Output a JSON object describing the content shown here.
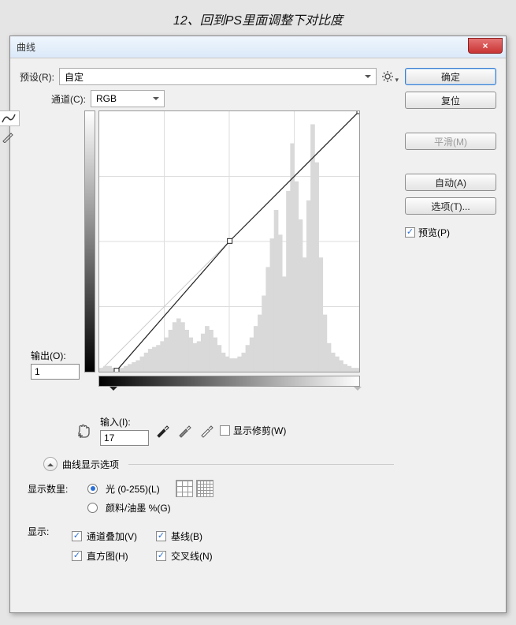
{
  "caption": "12、回到PS里面调整下对比度",
  "window": {
    "title": "曲线",
    "close_glyph": "×"
  },
  "preset": {
    "label": "预设(R):",
    "value": "自定"
  },
  "channel": {
    "label": "通道(C):",
    "value": "RGB"
  },
  "output": {
    "label": "输出(O):",
    "value": "1"
  },
  "input": {
    "label": "输入(I):",
    "value": "17"
  },
  "show_clip": {
    "label": "显示修剪(W)"
  },
  "expander": {
    "label": "曲线显示选项"
  },
  "show_amount": {
    "label": "显示数里:",
    "options": [
      {
        "label": "光 (0-255)(L)",
        "checked": true
      },
      {
        "label": "颜料/油墨 %(G)",
        "checked": false
      }
    ]
  },
  "show": {
    "label": "显示:",
    "checks": {
      "channel_overlay": {
        "label": "通道叠加(V)",
        "checked": true
      },
      "histogram": {
        "label": "直方图(H)",
        "checked": true
      },
      "baseline": {
        "label": "基线(B)",
        "checked": true
      },
      "intersection": {
        "label": "交叉线(N)",
        "checked": true
      }
    }
  },
  "buttons": {
    "ok": "确定",
    "reset": "复位",
    "smooth": "平滑(M)",
    "auto": "自动(A)",
    "options": "选项(T)..."
  },
  "preview": {
    "label": "预览(P)",
    "checked": true
  },
  "chart_data": {
    "type": "line",
    "title": "Curves",
    "xlabel": "Input",
    "ylabel": "Output",
    "xlim": [
      0,
      255
    ],
    "ylim": [
      0,
      255
    ],
    "series": [
      {
        "name": "curve",
        "x": [
          17,
          128,
          255
        ],
        "y": [
          1,
          128,
          255
        ]
      }
    ],
    "histogram_approx": [
      2,
      3,
      3,
      2,
      2,
      2,
      3,
      4,
      5,
      6,
      8,
      10,
      12,
      13,
      14,
      16,
      18,
      22,
      26,
      28,
      26,
      22,
      18,
      15,
      16,
      20,
      24,
      22,
      18,
      14,
      10,
      8,
      7,
      7,
      8,
      10,
      14,
      18,
      24,
      30,
      40,
      55,
      70,
      85,
      72,
      50,
      95,
      120,
      100,
      80,
      60,
      90,
      130,
      110,
      60,
      30,
      15,
      10,
      8,
      6,
      4,
      3,
      2,
      2
    ]
  }
}
